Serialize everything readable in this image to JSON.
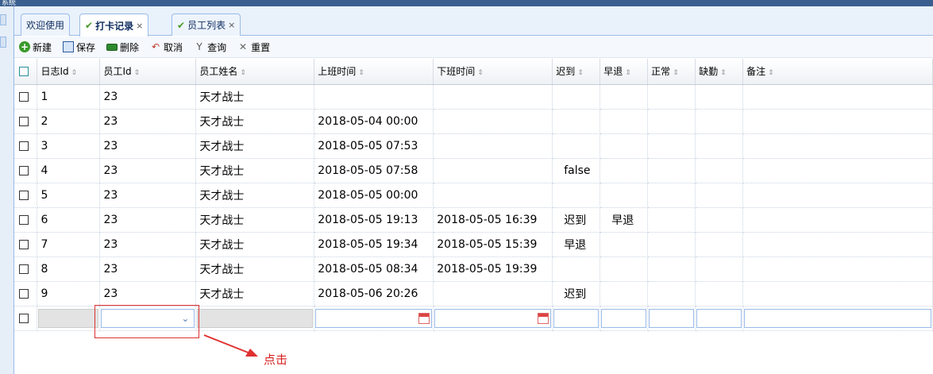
{
  "titlebar": {
    "text": "系统"
  },
  "tabs": [
    {
      "label": "欢迎使用",
      "closable": false,
      "active": false
    },
    {
      "label": "打卡记录",
      "closable": true,
      "active": true
    },
    {
      "label": "员工列表",
      "closable": true,
      "active": false
    }
  ],
  "toolbar": {
    "new_label": "新建",
    "save_label": "保存",
    "delete_label": "删除",
    "cancel_label": "取消",
    "query_label": "查询",
    "reset_label": "重置"
  },
  "grid": {
    "columns": [
      "日志Id",
      "员工Id",
      "员工姓名",
      "上班时间",
      "下班时间",
      "迟到",
      "早退",
      "正常",
      "缺勤",
      "备注"
    ],
    "rows": [
      [
        "1",
        "23",
        "天才战士",
        "",
        "",
        "",
        "",
        "",
        "",
        ""
      ],
      [
        "2",
        "23",
        "天才战士",
        "2018-05-04 00:00",
        "",
        "",
        "",
        "",
        "",
        ""
      ],
      [
        "3",
        "23",
        "天才战士",
        "2018-05-05 07:53",
        "",
        "",
        "",
        "",
        "",
        ""
      ],
      [
        "4",
        "23",
        "天才战士",
        "2018-05-05 07:58",
        "",
        "false",
        "",
        "",
        "",
        ""
      ],
      [
        "5",
        "23",
        "天才战士",
        "2018-05-05 00:00",
        "",
        "",
        "",
        "",
        "",
        ""
      ],
      [
        "6",
        "23",
        "天才战士",
        "2018-05-05 19:13",
        "2018-05-05 16:39",
        "迟到",
        "早退",
        "",
        "",
        ""
      ],
      [
        "7",
        "23",
        "天才战士",
        "2018-05-05 19:34",
        "2018-05-05 15:39",
        "早退",
        "",
        "",
        "",
        ""
      ],
      [
        "8",
        "23",
        "天才战士",
        "2018-05-05 08:34",
        "2018-05-05 19:39",
        "",
        "",
        "",
        "",
        ""
      ],
      [
        "9",
        "23",
        "天才战士",
        "2018-05-06 20:26",
        "",
        "迟到",
        "",
        "",
        "",
        ""
      ]
    ]
  },
  "annotation": {
    "text": "点击",
    "color": "#d82020"
  }
}
